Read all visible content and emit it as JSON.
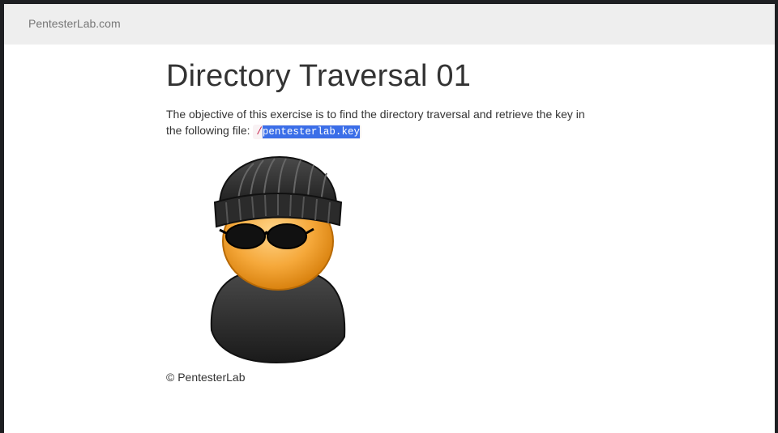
{
  "navbar": {
    "brand": "PentesterLab.com"
  },
  "main": {
    "title": "Directory Traversal 01",
    "description": "The objective of this exercise is to find the directory traversal and retrieve the key in the following file: ",
    "file_prefix": "/",
    "file_name": "pentesterlab.key",
    "image_icon": "hacker-avatar-icon"
  },
  "footer": {
    "copyright": "© PentesterLab"
  },
  "colors": {
    "navbar_bg": "#eeeeee",
    "selection": "#3b6ee8",
    "code_text": "#c7254e",
    "skin": "#f5a83a"
  }
}
